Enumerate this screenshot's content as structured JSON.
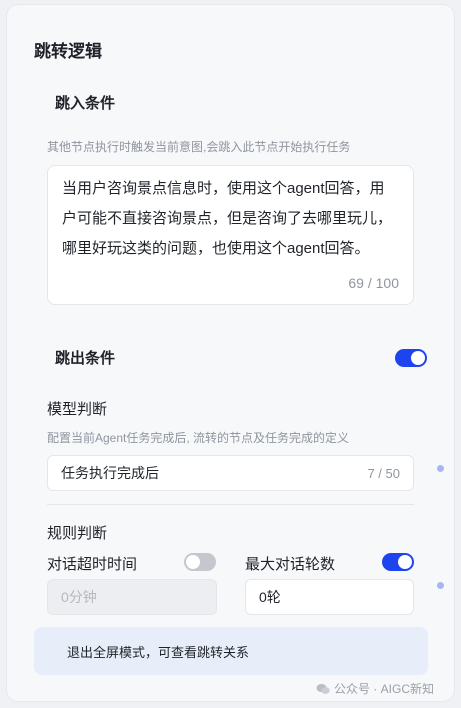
{
  "panel": {
    "title": "跳转逻辑"
  },
  "entry": {
    "title": "跳入条件",
    "hint": "其他节点执行时触发当前意图,会跳入此节点开始执行任务",
    "textarea_value": "当用户咨询景点信息时，使用这个agent回答，用户可能不直接咨询景点，但是咨询了去哪里玩儿，哪里好玩这类的问题，也使用这个agent回答。",
    "counter": "69 / 100"
  },
  "exit": {
    "title": "跳出条件",
    "toggle_on": true,
    "model": {
      "label": "模型判断",
      "hint": "配置当前Agent任务完成后, 流转的节点及任务完成的定义",
      "input_value": "任务执行完成后",
      "counter": "7 / 50"
    },
    "rule": {
      "label": "规则判断",
      "timeout_label": "对话超时时间",
      "timeout_toggle_on": false,
      "timeout_value": "0分钟",
      "max_turns_label": "最大对话轮数",
      "max_turns_toggle_on": true,
      "max_turns_value": "0轮"
    }
  },
  "banner": {
    "text": "退出全屏模式，可查看跳转关系"
  },
  "watermark": {
    "text": "公众号 · AIGC新知"
  },
  "colors": {
    "accent": "#1d44ee",
    "banner_bg": "#e8eef9",
    "toggle_off": "#c4c7cd"
  }
}
